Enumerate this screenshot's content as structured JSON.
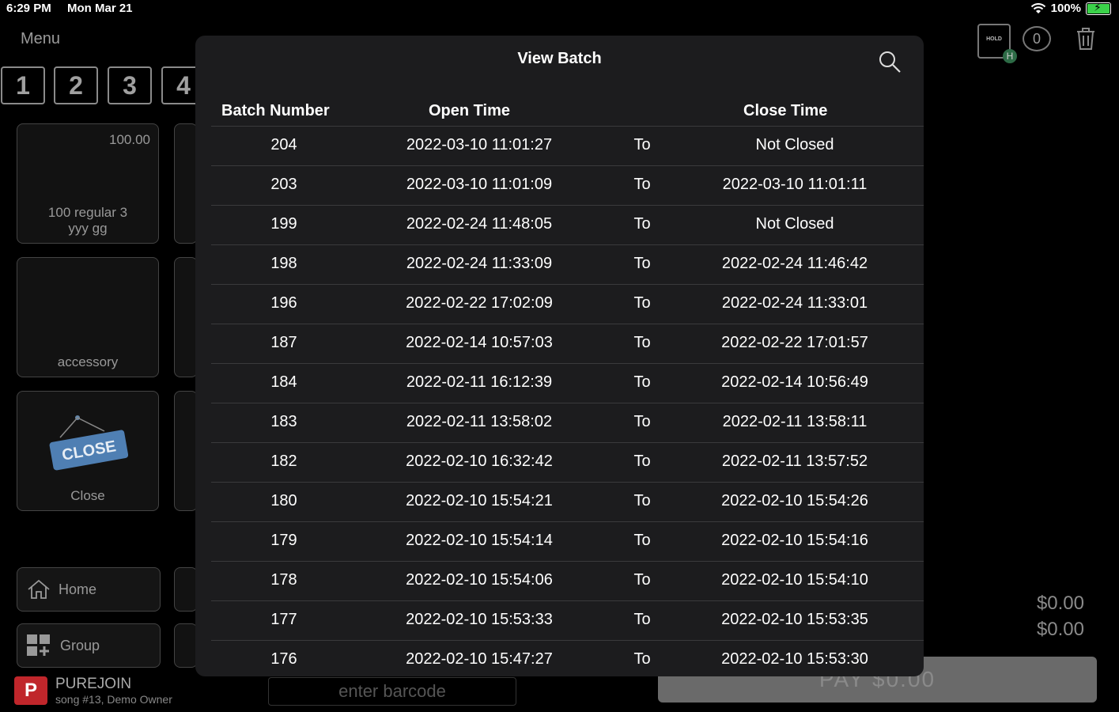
{
  "status_bar": {
    "time": "6:29 PM",
    "date": "Mon Mar 21",
    "wifi_icon": "wifi-icon",
    "battery_percent": "100%",
    "battery_icon": "battery-charging-icon"
  },
  "background": {
    "menu_label": "Menu",
    "num_tabs": [
      "1",
      "2",
      "3",
      "4"
    ],
    "tiles": [
      {
        "price": "100.00",
        "label_line1": "100  regular 3",
        "label_line2": "yyy gg"
      },
      {
        "label_line1": "accessory"
      },
      {
        "label_line1": "Close",
        "icon": "close-sign-icon"
      }
    ],
    "close_sign_text": "CLOSE",
    "nav": {
      "home_label": "Home",
      "home_icon": "home-icon",
      "group_label": "Group",
      "group_icon": "group-add-icon"
    },
    "brand": {
      "name": "PUREJOIN",
      "subtitle": "song #13, Demo Owner"
    },
    "barcode_placeholder": "enter barcode",
    "pay_label": "PAY $0.00",
    "totals": [
      "$0.00",
      "$0.00"
    ],
    "hold_icon_text": "HOLD",
    "hold_badge": "H",
    "cart_count": "0",
    "trash_icon": "trash-icon"
  },
  "modal": {
    "title": "View Batch",
    "search_icon": "search-icon",
    "columns": {
      "batch_number": "Batch Number",
      "open_time": "Open Time",
      "close_time": "Close Time"
    },
    "rows": [
      {
        "batch": "204",
        "open": "2022-03-10 11:01:27",
        "to": "To",
        "close": "Not Closed"
      },
      {
        "batch": "203",
        "open": "2022-03-10 11:01:09",
        "to": "To",
        "close": "2022-03-10 11:01:11"
      },
      {
        "batch": "199",
        "open": "2022-02-24 11:48:05",
        "to": "To",
        "close": "Not Closed"
      },
      {
        "batch": "198",
        "open": "2022-02-24 11:33:09",
        "to": "To",
        "close": "2022-02-24 11:46:42"
      },
      {
        "batch": "196",
        "open": "2022-02-22 17:02:09",
        "to": "To",
        "close": "2022-02-24 11:33:01"
      },
      {
        "batch": "187",
        "open": "2022-02-14 10:57:03",
        "to": "To",
        "close": "2022-02-22 17:01:57"
      },
      {
        "batch": "184",
        "open": "2022-02-11 16:12:39",
        "to": "To",
        "close": "2022-02-14 10:56:49"
      },
      {
        "batch": "183",
        "open": "2022-02-11 13:58:02",
        "to": "To",
        "close": "2022-02-11 13:58:11"
      },
      {
        "batch": "182",
        "open": "2022-02-10 16:32:42",
        "to": "To",
        "close": "2022-02-11 13:57:52"
      },
      {
        "batch": "180",
        "open": "2022-02-10 15:54:21",
        "to": "To",
        "close": "2022-02-10 15:54:26"
      },
      {
        "batch": "179",
        "open": "2022-02-10 15:54:14",
        "to": "To",
        "close": "2022-02-10 15:54:16"
      },
      {
        "batch": "178",
        "open": "2022-02-10 15:54:06",
        "to": "To",
        "close": "2022-02-10 15:54:10"
      },
      {
        "batch": "177",
        "open": "2022-02-10 15:53:33",
        "to": "To",
        "close": "2022-02-10 15:53:35"
      },
      {
        "batch": "176",
        "open": "2022-02-10 15:47:27",
        "to": "To",
        "close": "2022-02-10 15:53:30"
      }
    ]
  }
}
